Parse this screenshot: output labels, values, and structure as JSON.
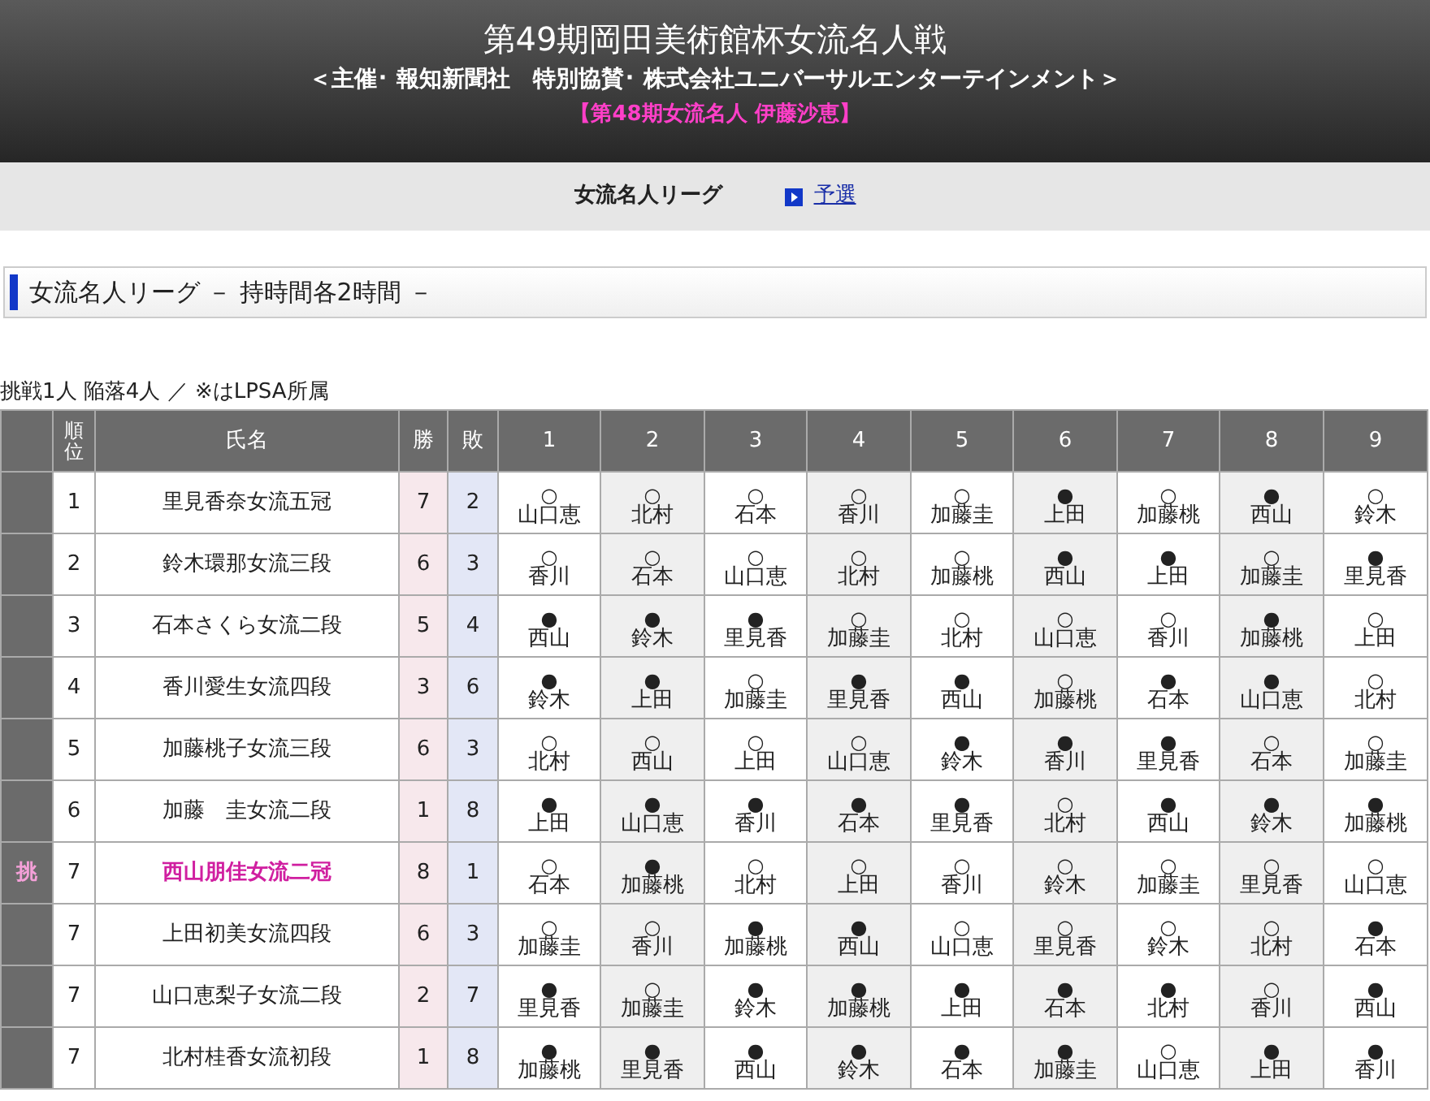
{
  "header": {
    "title": "第49期岡田美術館杯女流名人戦",
    "sponsor": "＜主催･ 報知新聞社　特別協賛･ 株式会社ユニバーサルエンターテインメント＞",
    "champion": "【第48期女流名人 伊藤沙恵】"
  },
  "nav": [
    {
      "label": "女流名人リーグ",
      "selected": true
    },
    {
      "label": "予選",
      "selected": false
    }
  ],
  "section_title": "女流名人リーグ － 持時間各2時間 －",
  "note": "挑戦1人 陥落4人 ／ ※はLPSA所属",
  "table": {
    "columns": [
      "順位",
      "氏名",
      "勝",
      "敗",
      "1",
      "2",
      "3",
      "4",
      "5",
      "6",
      "7",
      "8",
      "9"
    ],
    "rows": [
      {
        "side": "",
        "challenger": false,
        "rank": "1",
        "name": "里見香奈女流五冠",
        "wins": "7",
        "losses": "2",
        "results": [
          {
            "mark": "○",
            "opponent": "山口恵"
          },
          {
            "mark": "○",
            "opponent": "北村"
          },
          {
            "mark": "○",
            "opponent": "石本"
          },
          {
            "mark": "○",
            "opponent": "香川"
          },
          {
            "mark": "○",
            "opponent": "加藤圭"
          },
          {
            "mark": "●",
            "opponent": "上田"
          },
          {
            "mark": "○",
            "opponent": "加藤桃"
          },
          {
            "mark": "●",
            "opponent": "西山"
          },
          {
            "mark": "○",
            "opponent": "鈴木"
          }
        ]
      },
      {
        "side": "",
        "challenger": false,
        "rank": "2",
        "name": "鈴木環那女流三段",
        "wins": "6",
        "losses": "3",
        "results": [
          {
            "mark": "○",
            "opponent": "香川"
          },
          {
            "mark": "○",
            "opponent": "石本"
          },
          {
            "mark": "○",
            "opponent": "山口恵"
          },
          {
            "mark": "○",
            "opponent": "北村"
          },
          {
            "mark": "○",
            "opponent": "加藤桃"
          },
          {
            "mark": "●",
            "opponent": "西山"
          },
          {
            "mark": "●",
            "opponent": "上田"
          },
          {
            "mark": "○",
            "opponent": "加藤圭"
          },
          {
            "mark": "●",
            "opponent": "里見香"
          }
        ]
      },
      {
        "side": "",
        "challenger": false,
        "rank": "3",
        "name": "石本さくら女流二段",
        "wins": "5",
        "losses": "4",
        "results": [
          {
            "mark": "●",
            "opponent": "西山"
          },
          {
            "mark": "●",
            "opponent": "鈴木"
          },
          {
            "mark": "●",
            "opponent": "里見香"
          },
          {
            "mark": "○",
            "opponent": "加藤圭"
          },
          {
            "mark": "○",
            "opponent": "北村"
          },
          {
            "mark": "○",
            "opponent": "山口恵"
          },
          {
            "mark": "○",
            "opponent": "香川"
          },
          {
            "mark": "●",
            "opponent": "加藤桃"
          },
          {
            "mark": "○",
            "opponent": "上田"
          }
        ]
      },
      {
        "side": "",
        "challenger": false,
        "rank": "4",
        "name": "香川愛生女流四段",
        "wins": "3",
        "losses": "6",
        "results": [
          {
            "mark": "●",
            "opponent": "鈴木"
          },
          {
            "mark": "●",
            "opponent": "上田"
          },
          {
            "mark": "○",
            "opponent": "加藤圭"
          },
          {
            "mark": "●",
            "opponent": "里見香"
          },
          {
            "mark": "●",
            "opponent": "西山"
          },
          {
            "mark": "○",
            "opponent": "加藤桃"
          },
          {
            "mark": "●",
            "opponent": "石本"
          },
          {
            "mark": "●",
            "opponent": "山口恵"
          },
          {
            "mark": "○",
            "opponent": "北村"
          }
        ]
      },
      {
        "side": "",
        "challenger": false,
        "rank": "5",
        "name": "加藤桃子女流三段",
        "wins": "6",
        "losses": "3",
        "results": [
          {
            "mark": "○",
            "opponent": "北村"
          },
          {
            "mark": "○",
            "opponent": "西山"
          },
          {
            "mark": "○",
            "opponent": "上田"
          },
          {
            "mark": "○",
            "opponent": "山口恵"
          },
          {
            "mark": "●",
            "opponent": "鈴木"
          },
          {
            "mark": "●",
            "opponent": "香川"
          },
          {
            "mark": "●",
            "opponent": "里見香"
          },
          {
            "mark": "○",
            "opponent": "石本"
          },
          {
            "mark": "○",
            "opponent": "加藤圭"
          }
        ]
      },
      {
        "side": "",
        "challenger": false,
        "rank": "6",
        "name": "加藤　圭女流二段",
        "wins": "1",
        "losses": "8",
        "results": [
          {
            "mark": "●",
            "opponent": "上田"
          },
          {
            "mark": "●",
            "opponent": "山口恵"
          },
          {
            "mark": "●",
            "opponent": "香川"
          },
          {
            "mark": "●",
            "opponent": "石本"
          },
          {
            "mark": "●",
            "opponent": "里見香"
          },
          {
            "mark": "○",
            "opponent": "北村"
          },
          {
            "mark": "●",
            "opponent": "西山"
          },
          {
            "mark": "●",
            "opponent": "鈴木"
          },
          {
            "mark": "●",
            "opponent": "加藤桃"
          }
        ]
      },
      {
        "side": "挑",
        "challenger": true,
        "rank": "7",
        "name": "西山朋佳女流二冠",
        "wins": "8",
        "losses": "1",
        "results": [
          {
            "mark": "○",
            "opponent": "石本"
          },
          {
            "mark": "●",
            "opponent": "加藤桃"
          },
          {
            "mark": "○",
            "opponent": "北村"
          },
          {
            "mark": "○",
            "opponent": "上田"
          },
          {
            "mark": "○",
            "opponent": "香川"
          },
          {
            "mark": "○",
            "opponent": "鈴木"
          },
          {
            "mark": "○",
            "opponent": "加藤圭"
          },
          {
            "mark": "○",
            "opponent": "里見香"
          },
          {
            "mark": "○",
            "opponent": "山口恵"
          }
        ]
      },
      {
        "side": "",
        "challenger": false,
        "rank": "7",
        "name": "上田初美女流四段",
        "wins": "6",
        "losses": "3",
        "results": [
          {
            "mark": "○",
            "opponent": "加藤圭"
          },
          {
            "mark": "○",
            "opponent": "香川"
          },
          {
            "mark": "●",
            "opponent": "加藤桃"
          },
          {
            "mark": "●",
            "opponent": "西山"
          },
          {
            "mark": "○",
            "opponent": "山口恵"
          },
          {
            "mark": "○",
            "opponent": "里見香"
          },
          {
            "mark": "○",
            "opponent": "鈴木"
          },
          {
            "mark": "○",
            "opponent": "北村"
          },
          {
            "mark": "●",
            "opponent": "石本"
          }
        ]
      },
      {
        "side": "",
        "challenger": false,
        "rank": "7",
        "name": "山口恵梨子女流二段",
        "wins": "2",
        "losses": "7",
        "results": [
          {
            "mark": "●",
            "opponent": "里見香"
          },
          {
            "mark": "○",
            "opponent": "加藤圭"
          },
          {
            "mark": "●",
            "opponent": "鈴木"
          },
          {
            "mark": "●",
            "opponent": "加藤桃"
          },
          {
            "mark": "●",
            "opponent": "上田"
          },
          {
            "mark": "●",
            "opponent": "石本"
          },
          {
            "mark": "●",
            "opponent": "北村"
          },
          {
            "mark": "○",
            "opponent": "香川"
          },
          {
            "mark": "●",
            "opponent": "西山"
          }
        ]
      },
      {
        "side": "",
        "challenger": false,
        "rank": "7",
        "name": "北村桂香女流初段",
        "wins": "1",
        "losses": "8",
        "results": [
          {
            "mark": "●",
            "opponent": "加藤桃"
          },
          {
            "mark": "●",
            "opponent": "里見香"
          },
          {
            "mark": "●",
            "opponent": "西山"
          },
          {
            "mark": "●",
            "opponent": "鈴木"
          },
          {
            "mark": "●",
            "opponent": "石本"
          },
          {
            "mark": "●",
            "opponent": "加藤圭"
          },
          {
            "mark": "○",
            "opponent": "山口恵"
          },
          {
            "mark": "●",
            "opponent": "上田"
          },
          {
            "mark": "●",
            "opponent": "香川"
          }
        ]
      }
    ]
  }
}
